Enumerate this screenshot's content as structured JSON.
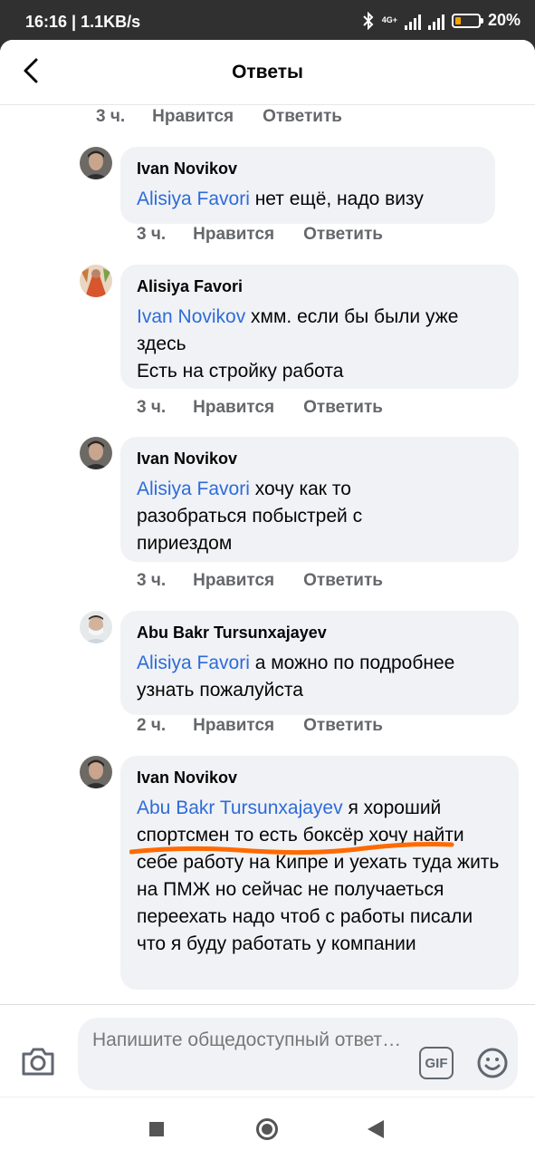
{
  "status_bar": {
    "time_speed": "16:16 | 1.1KB/s",
    "network": "4G+",
    "battery": "20%"
  },
  "header": {
    "title": "Ответы"
  },
  "actions_labels": {
    "like": "Нравится",
    "reply": "Ответить"
  },
  "top_actions": {
    "time": "3 ч."
  },
  "comments": [
    {
      "author": "Ivan Novikov",
      "mention": "Alisiya Favori",
      "text": "  нет ещё, надо визу",
      "time": "3 ч."
    },
    {
      "author": "Alisiya Favori",
      "mention": "Ivan Novikov",
      "text": " хмм. если бы были уже здесь\n Есть на стройку работа",
      "time": "3 ч."
    },
    {
      "author": "Ivan Novikov",
      "mention": "Alisiya Favori",
      "text": "  хочу как то разобраться побыстрей с пириездом",
      "time": "3 ч."
    },
    {
      "author": "Abu Bakr Tursunxajayev",
      "mention": "Alisiya Favori",
      "text": " а можно по подробнее узнать пожалуйста",
      "time": "2 ч."
    },
    {
      "author": "Ivan Novikov",
      "mention": "Abu Bakr Tursunxajayev",
      "text": " я хороший спортсмен то есть боксёр хочу найти себе работу на Кипре и уехать туда жить на ПМЖ но сейчас не получаеться переехать надо чтоб с работы писали что я буду работать у компании"
    }
  ],
  "composer": {
    "placeholder": "Напишите общедоступный ответ…",
    "gif_label": "GIF"
  },
  "colors": {
    "mention": "#2e6bd9",
    "bubble": "#f0f2f5",
    "markup_stroke": "#ff6a00"
  }
}
